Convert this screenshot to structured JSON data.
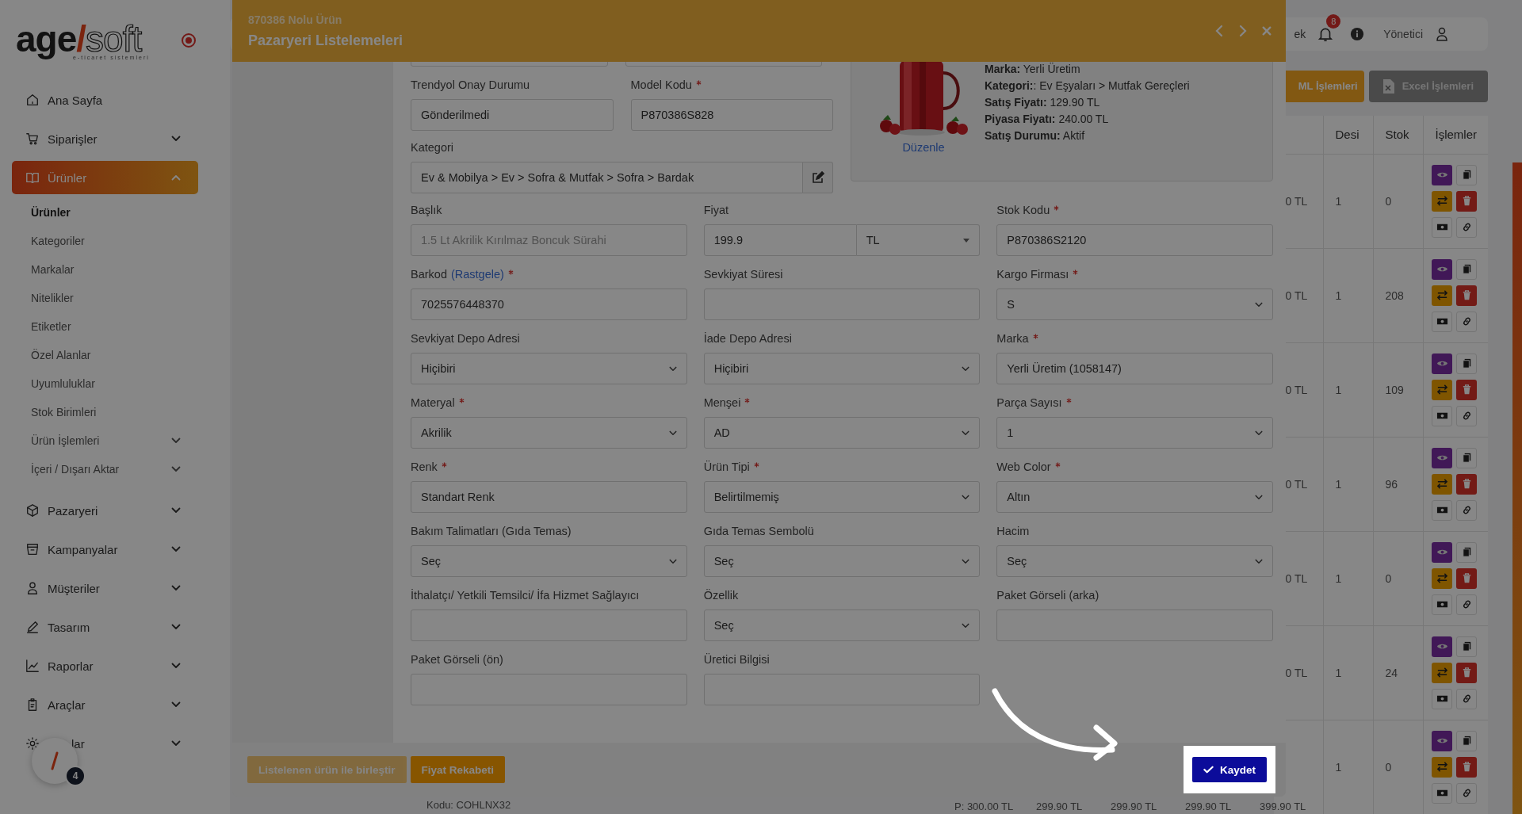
{
  "sidebar": {
    "logo": {
      "brand_left": "age",
      "slash": "/",
      "brand_right": "soft",
      "tagline": "e-ticaret sistemleri"
    },
    "items": [
      {
        "label": "Ana Sayfa",
        "selected": false
      },
      {
        "label": "Siparişler",
        "selected": false,
        "expanded": false
      },
      {
        "label": "Ürünler",
        "selected": true,
        "expanded": true,
        "children": [
          {
            "label": "Ürünler",
            "selected": true
          },
          {
            "label": "Kategoriler",
            "selected": false
          },
          {
            "label": "Markalar",
            "selected": false
          },
          {
            "label": "Nitelikler",
            "selected": false
          },
          {
            "label": "Etiketler",
            "selected": false
          },
          {
            "label": "Özel Alanlar",
            "selected": false
          },
          {
            "label": "Uyumluluklar",
            "selected": false
          },
          {
            "label": "Stok Birimleri",
            "selected": false
          },
          {
            "label": "Ürün İşlemleri",
            "selected": false,
            "expanded": false
          },
          {
            "label": "İçeri / Dışarı Aktar",
            "selected": false,
            "expanded": false
          }
        ]
      },
      {
        "label": "Pazaryeri",
        "selected": false,
        "expanded": false
      },
      {
        "label": "Kampanyalar",
        "selected": false,
        "expanded": false
      },
      {
        "label": "Müşteriler",
        "selected": false,
        "expanded": false
      },
      {
        "label": "Tasarım",
        "selected": false,
        "expanded": false
      },
      {
        "label": "Raporlar",
        "selected": false,
        "expanded": false
      },
      {
        "label": "Araçlar",
        "selected": false,
        "expanded": false
      },
      {
        "label": "lar",
        "selected": false,
        "expanded": false
      }
    ]
  },
  "floating_button": {
    "badge": "4"
  },
  "topbar": {
    "partial_text": "ek",
    "notifications": "8",
    "user": "Yönetici"
  },
  "actions": [
    {
      "label": "ML İşlemleri",
      "kind": "xml"
    },
    {
      "label": "Excel İşlemleri",
      "kind": "excel"
    }
  ],
  "table": {
    "columns": [
      "Desi",
      "Stok",
      "İşlemler"
    ],
    "rows": [
      {
        "column_1": "0 TL",
        "desi": "1",
        "stok": "0"
      },
      {
        "column_1": "0 TL",
        "desi": "1",
        "stok": "208"
      },
      {
        "column_1": "0 TL",
        "desi": "1",
        "stok": "109"
      },
      {
        "column_1": "0 TL",
        "desi": "1",
        "stok": "96"
      },
      {
        "column_1": "0 TL",
        "desi": "1",
        "stok": "0"
      },
      {
        "column_1": "0 TL",
        "desi": "1",
        "stok": "24"
      },
      {
        "desi": "1",
        "stok": "0"
      }
    ]
  },
  "bottom_row": {
    "code": "Kodu: COHLNX32",
    "list_price": "P: 300.00 TL",
    "prices": [
      "299.90 TL",
      "299.90 TL",
      "299.90 TL",
      "399.90 TL"
    ]
  },
  "modal": {
    "subtitle": "870386 Nolu Ürün",
    "title": "Pazaryeri Listelemeleri",
    "top_fields": [
      {
        "label": "Trendyol Onay Durumu",
        "required": false,
        "value": "Gönderilmedi"
      },
      {
        "label": "Model Kodu",
        "required": true,
        "value": "P870386S828"
      }
    ],
    "category": {
      "label": "Kategori",
      "value": "Ev & Mobilya > Ev > Sofra & Mutfak > Sofra > Bardak"
    },
    "product_card": {
      "lines": [
        "**Marka:** Yerli Üretim",
        "**Kategori:**: Ev Eşyaları > Mutfak Gereçleri",
        "**Satış Fiyatı:** 129.90 TL",
        "**Piyasa Fiyatı:** 240.00 TL",
        "**Satış Durumu:** Aktif"
      ],
      "edit_link": "Düzenle"
    },
    "fields": [
      {
        "label": "Başlık",
        "kind": "text",
        "required": false,
        "placeholder": "1.5 Lt Akrilik Kırılmaz Boncuk Sürahi"
      },
      {
        "label": "Fiyat",
        "kind": "price",
        "required": false,
        "value": "199.9",
        "currency": "TL"
      },
      {
        "label": "Stok Kodu",
        "kind": "text",
        "required": true,
        "value": "P870386S2120"
      },
      {
        "label": "Barkod",
        "label_link": "(Rastgele)",
        "kind": "text",
        "required": true,
        "value": "7025576448370"
      },
      {
        "label": "Sevkiyat Süresi",
        "kind": "text",
        "required": false
      },
      {
        "label": "Kargo Firması",
        "kind": "select",
        "required": true,
        "value": "S"
      },
      {
        "label": "Sevkiyat Depo Adresi",
        "kind": "select",
        "required": false,
        "value": "Hiçibiri"
      },
      {
        "label": "İade Depo Adresi",
        "kind": "select",
        "required": false,
        "value": "Hiçibiri"
      },
      {
        "label": "Marka",
        "kind": "text",
        "required": true,
        "value": "Yerli Üretim (1058147)"
      },
      {
        "label": "Materyal",
        "kind": "select",
        "required": true,
        "value": "Akrilik"
      },
      {
        "label": "Menşei",
        "kind": "select",
        "required": true,
        "value": "AD"
      },
      {
        "label": "Parça Sayısı",
        "kind": "select",
        "required": true,
        "value": "1"
      },
      {
        "label": "Renk",
        "kind": "text",
        "required": true,
        "value": "Standart Renk"
      },
      {
        "label": "Ürün Tipi",
        "kind": "select",
        "required": true,
        "value": "Belirtilmemiş"
      },
      {
        "label": "Web Color",
        "kind": "select",
        "required": true,
        "value": "Altın"
      },
      {
        "label": "Bakım Talimatları (Gıda Temas)",
        "kind": "select",
        "required": false,
        "value": "Seç"
      },
      {
        "label": "Gıda Temas Sembolü",
        "kind": "select",
        "required": false,
        "value": "Seç"
      },
      {
        "label": "Hacim",
        "kind": "select",
        "required": false,
        "value": "Seç"
      },
      {
        "label": "İthalatçı/ Yetkili Temsilci/ İfa Hizmet Sağlayıcı",
        "kind": "text",
        "required": false
      },
      {
        "label": "Özellik",
        "kind": "select",
        "required": false,
        "value": "Seç"
      },
      {
        "label": "Paket Görseli (arka)",
        "kind": "text",
        "required": false
      },
      {
        "label": "Paket Görseli (ön)",
        "kind": "text",
        "required": false
      },
      {
        "label": "Üretici Bilgisi",
        "kind": "text",
        "required": false
      }
    ],
    "footer_buttons": [
      {
        "label": "Listelenen ürün ile birleştir",
        "disabled": true
      },
      {
        "label": "Fiyat Rekabeti",
        "disabled": false
      }
    ],
    "save_button": {
      "label": "Kaydet",
      "highlighted": true
    }
  }
}
